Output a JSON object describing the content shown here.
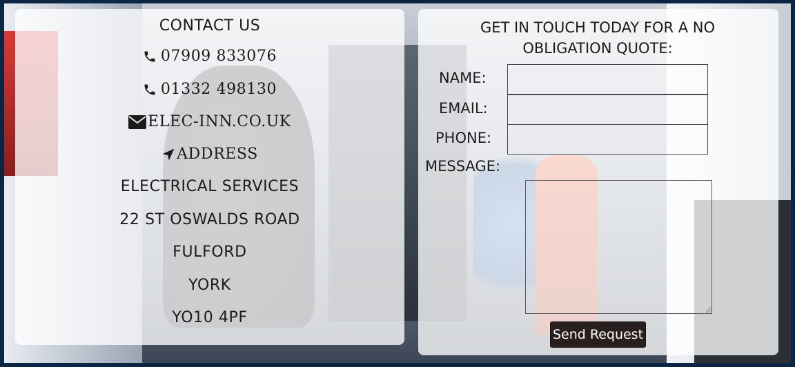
{
  "contact": {
    "heading": "CONTACT US",
    "phone_1": "07909 833076",
    "phone_2": "01332 498130",
    "email": "ELEC-INN.CO.UK",
    "address_label": "ADDRESS",
    "address_lines": [
      "ELECTRICAL SERVICES",
      "22 ST OSWALDS ROAD",
      "FULFORD",
      "YORK",
      "YO10 4PF"
    ]
  },
  "quote_form": {
    "heading": "GET IN TOUCH TODAY FOR A NO OBLIGATION QUOTE:",
    "name_label": "NAME:",
    "name_value": "",
    "email_label": "EMAIL:",
    "email_value": "",
    "phone_label": "PHONE:",
    "phone_value": "",
    "message_label": "MESSAGE:",
    "message_value": "",
    "submit_label": "Send Request"
  },
  "icons": {
    "phone": "phone-icon",
    "email": "envelope-icon",
    "address": "location-arrow-icon"
  },
  "colors": {
    "page_background": "#0b2545",
    "panel_overlay": "rgba(255,255,255,0.78)",
    "button_background": "#2a1f1f",
    "button_text": "#ffffff"
  }
}
